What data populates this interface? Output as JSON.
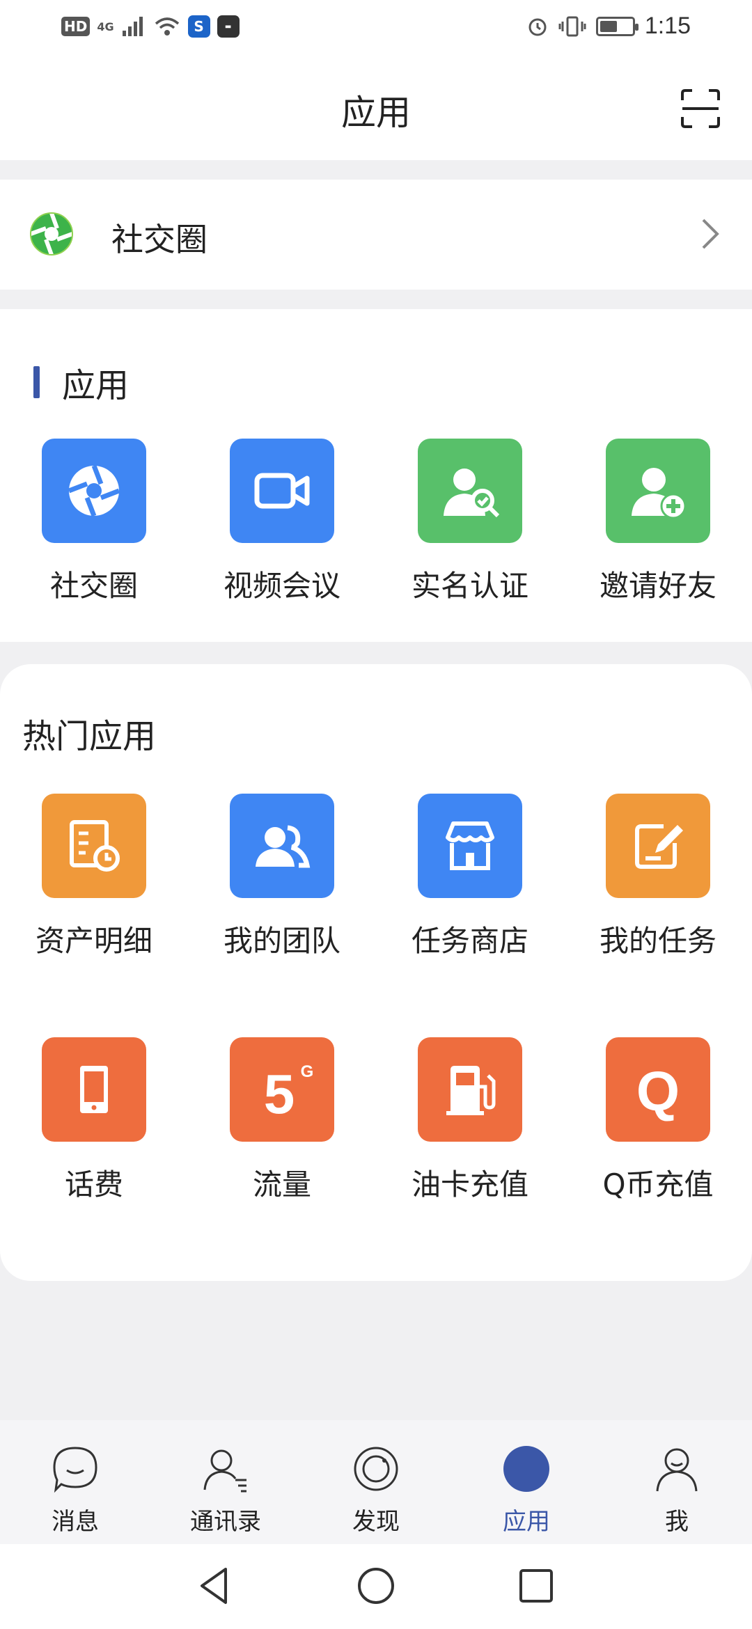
{
  "status_bar": {
    "hd": "HD",
    "network": "4G",
    "time": "1:15",
    "battery_level": 0.55,
    "icons": [
      "signal-icon",
      "wifi-icon",
      "app-s-icon",
      "huawei-icon",
      "alarm-icon",
      "vibrate-icon",
      "battery-icon"
    ]
  },
  "header": {
    "title": "应用",
    "scan_icon": "scan-icon"
  },
  "social_row": {
    "label": "社交圈",
    "icon": "aperture-icon"
  },
  "apps_section": {
    "title": "应用",
    "accent_color": "#3b57a8",
    "items": [
      {
        "label": "社交圈",
        "icon": "aperture-icon",
        "color": "#3f86f3"
      },
      {
        "label": "视频会议",
        "icon": "video-camera-icon",
        "color": "#3f86f3"
      },
      {
        "label": "实名认证",
        "icon": "user-verify-icon",
        "color": "#58c06a"
      },
      {
        "label": "邀请好友",
        "icon": "user-add-icon",
        "color": "#58c06a"
      }
    ]
  },
  "hot_apps": {
    "title": "热门应用",
    "rows": [
      [
        {
          "label": "资产明细",
          "icon": "asset-list-icon",
          "color": "#f0993a"
        },
        {
          "label": "我的团队",
          "icon": "team-icon",
          "color": "#3f86f3"
        },
        {
          "label": "任务商店",
          "icon": "store-icon",
          "color": "#3f86f3"
        },
        {
          "label": "我的任务",
          "icon": "edit-task-icon",
          "color": "#f0993a"
        }
      ],
      [
        {
          "label": "话费",
          "icon": "phone-icon",
          "color": "#ee6d3e"
        },
        {
          "label": "流量",
          "icon": "5g-icon",
          "color": "#ee6d3e",
          "glyph": "5",
          "sup": "G"
        },
        {
          "label": "油卡充值",
          "icon": "fuel-icon",
          "color": "#ee6d3e"
        },
        {
          "label": "Q币充值",
          "icon": "q-coin-icon",
          "color": "#ee6d3e",
          "glyph": "Q"
        }
      ]
    ]
  },
  "bottom_nav": {
    "active": "应用",
    "active_color": "#3b57a8",
    "items": [
      {
        "label": "消息",
        "icon": "chat-bubble-icon"
      },
      {
        "label": "通讯录",
        "icon": "contacts-icon"
      },
      {
        "label": "发现",
        "icon": "discover-icon"
      },
      {
        "label": "应用",
        "icon": "apps-icon"
      },
      {
        "label": "我",
        "icon": "profile-icon"
      }
    ]
  },
  "system_nav": [
    "back-icon",
    "home-icon",
    "recents-icon"
  ]
}
